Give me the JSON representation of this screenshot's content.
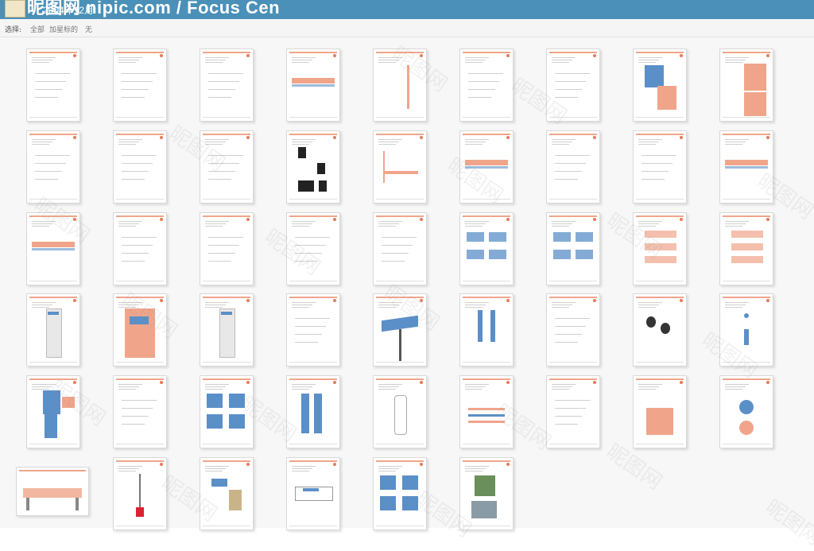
{
  "header": {
    "site_title": "昵图网 nipic.com / Focus Cen",
    "date": "2004年12月"
  },
  "filter": {
    "label": "选择:",
    "options": [
      "全部",
      "加星标的",
      "无"
    ]
  },
  "watermark": "昵图网",
  "colors": {
    "accent_orange": "#f0a58a",
    "accent_blue": "#5b8fc7",
    "header_blue": "#4a90b8"
  },
  "gallery": {
    "rows": [
      [
        "text-page",
        "text-page",
        "text-page",
        "banner-page",
        "letterhead",
        "letter",
        "text-list",
        "blue-orange-cards",
        "orange-cover"
      ],
      [
        "narrow-doc",
        "form-page",
        "text-page",
        "black-samples",
        "envelope",
        "banner-page",
        "text-page",
        "tall-docs",
        "banner-page"
      ],
      [
        "banner-page",
        "grid-page",
        "white-frame",
        "frame-page",
        "forms",
        "vehicles",
        "trucks",
        "cards-stack",
        "cards-stack"
      ],
      [
        "signboard",
        "orange-poster",
        "standing-sign",
        "gray-panel",
        "billboard",
        "ties",
        "hangers",
        "watches",
        "small-items"
      ],
      [
        "uniform-person",
        "outlines",
        "jackets",
        "trousers",
        "bottle",
        "stripes",
        "doc-page",
        "orange-box",
        "badges"
      ],
      [
        "wide-sign",
        "flag-pole",
        "flag-tree",
        "gate-sign",
        "shirts-grid",
        "photos"
      ]
    ]
  }
}
